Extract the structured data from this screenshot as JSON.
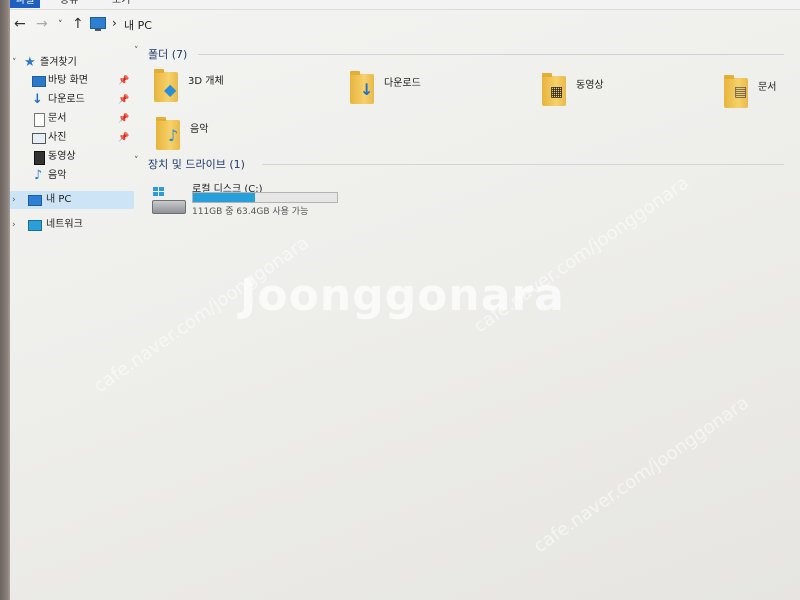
{
  "ribbon": {
    "tabs": [
      "파일",
      "공유",
      "보기"
    ]
  },
  "address": {
    "separator": "›",
    "location": "내 PC"
  },
  "nav": {
    "quick_access": "즐겨찾기",
    "quick_items": [
      {
        "label": "바탕 화면",
        "icon": "desktop-icon",
        "pinned": true
      },
      {
        "label": "다운로드",
        "icon": "download-icon",
        "pinned": true
      },
      {
        "label": "문서",
        "icon": "documents-icon",
        "pinned": true
      },
      {
        "label": "사진",
        "icon": "pictures-icon",
        "pinned": true
      },
      {
        "label": "동영상",
        "icon": "videos-icon",
        "pinned": false
      },
      {
        "label": "음악",
        "icon": "music-icon",
        "pinned": false
      }
    ],
    "this_pc": "내 PC",
    "network": "네트워크"
  },
  "folders": {
    "header": "폴더 (7)",
    "items": [
      "3D 개체",
      "다운로드",
      "동영상",
      "문서",
      "음악"
    ]
  },
  "drives": {
    "header": "장치 및 드라이브 (1)",
    "items": [
      {
        "name": "로컬 디스크 (C:)",
        "free_text": "111GB 중 63.4GB 사용 가능",
        "used_fraction": 0.43
      }
    ]
  },
  "watermark": {
    "main": "Joonggonara",
    "url": "cafe.naver.com/joonggonara"
  },
  "colors": {
    "accent": "#26a0da",
    "selection": "#cde4f7",
    "file_tab": "#1f5fbf"
  }
}
